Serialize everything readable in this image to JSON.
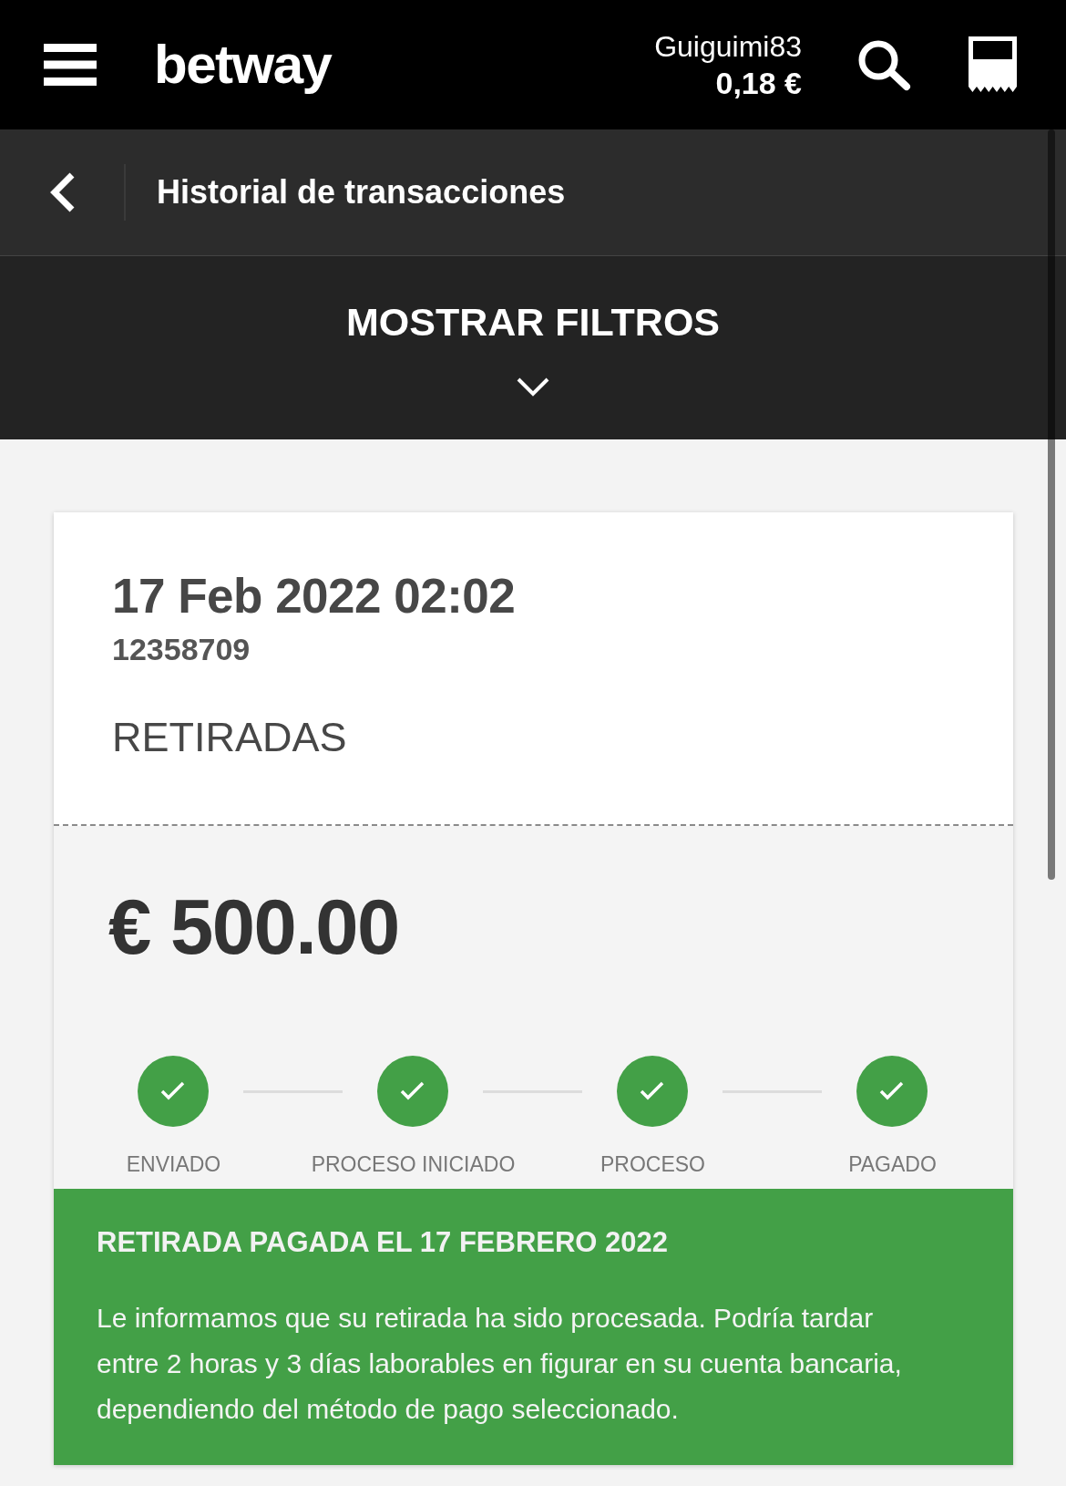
{
  "header": {
    "logo": "betway",
    "username": "Guiguimi83",
    "balance": "0,18 €"
  },
  "title_bar": {
    "title": "Historial de transacciones"
  },
  "filters": {
    "label": "MOSTRAR FILTROS",
    "expanded": false
  },
  "transaction": {
    "datetime": "17 Feb 2022 02:02",
    "reference": "12358709",
    "type": "RETIRADAS",
    "amount": "€ 500.00",
    "steps": [
      {
        "label": "ENVIADO",
        "done": true
      },
      {
        "label": "PROCESO INICIADO",
        "done": true
      },
      {
        "label": "PROCESO",
        "done": true
      },
      {
        "label": "PAGADO",
        "done": true
      }
    ],
    "notice": {
      "title": "RETIRADA PAGADA EL 17 FEBRERO 2022",
      "message": "Le informamos que su retirada ha sido procesada. Podría tardar entre 2 horas y 3 días laborables en figurar en su cuenta bancaria, dependiendo del método de pago seleccionado."
    }
  }
}
